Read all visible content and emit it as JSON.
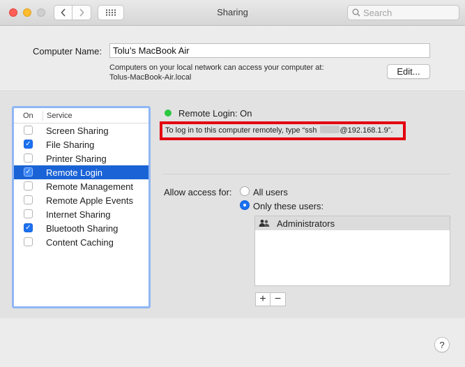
{
  "window": {
    "title": "Sharing"
  },
  "search": {
    "placeholder": "Search"
  },
  "computer_name": {
    "label": "Computer Name:",
    "value": "Tolu’s MacBook Air",
    "description_line1": "Computers on your local network can access your computer at:",
    "description_line2": "Tolus-MacBook-Air.local",
    "edit_label": "Edit..."
  },
  "services": {
    "header_on": "On",
    "header_service": "Service",
    "items": [
      {
        "label": "Screen Sharing",
        "checked": false
      },
      {
        "label": "File Sharing",
        "checked": true
      },
      {
        "label": "Printer Sharing",
        "checked": false
      },
      {
        "label": "Remote Login",
        "checked": true,
        "selected": true
      },
      {
        "label": "Remote Management",
        "checked": false
      },
      {
        "label": "Remote Apple Events",
        "checked": false
      },
      {
        "label": "Internet Sharing",
        "checked": false
      },
      {
        "label": "Bluetooth Sharing",
        "checked": true
      },
      {
        "label": "Content Caching",
        "checked": false
      }
    ]
  },
  "status": {
    "text": "Remote Login: On",
    "color": "#2bc840"
  },
  "login_hint": {
    "prefix": "To log in to this computer remotely, type “ssh ",
    "suffix": "@192.168.1.9”."
  },
  "access": {
    "label": "Allow access for:",
    "all_users": "All users",
    "only_these_users": "Only these users:",
    "selected_option": "only_these_users",
    "users": [
      "Administrators"
    ]
  },
  "controls": {
    "add": "+",
    "remove": "−",
    "help": "?"
  },
  "colors": {
    "accent": "#1a71f2",
    "selection": "#1a63d6",
    "highlight_border": "#e3000f"
  }
}
